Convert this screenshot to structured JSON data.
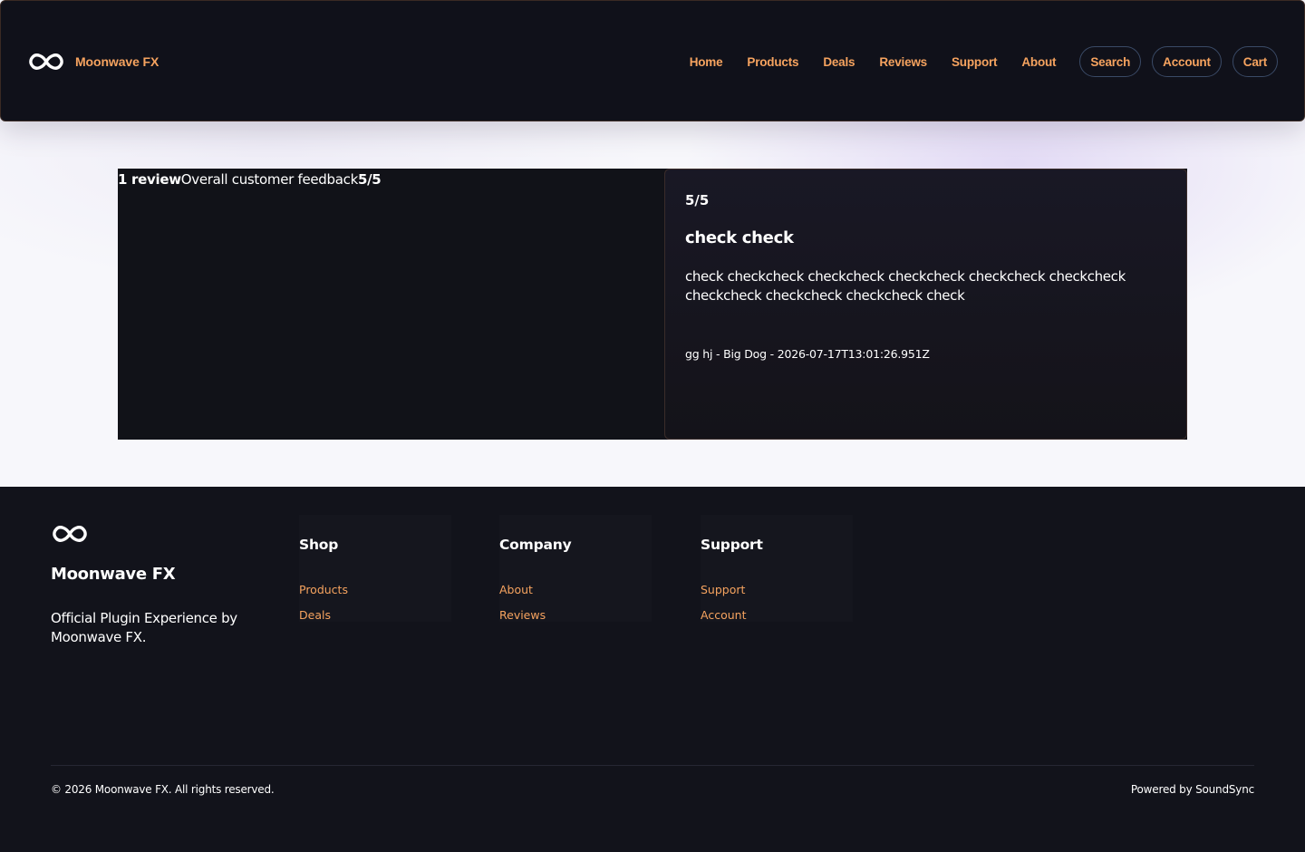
{
  "header": {
    "brand_name": "Moonwave FX",
    "nav_links": [
      "Home",
      "Products",
      "Deals",
      "Reviews",
      "Support",
      "About"
    ],
    "nav_pills": [
      "Search",
      "Account",
      "Cart"
    ]
  },
  "reviews": {
    "summary": {
      "count_label": "1 review",
      "caption": "Overall customer feedback",
      "average": "5/5"
    },
    "items": [
      {
        "score": "5/5",
        "title": "check check",
        "body": "check checkcheck checkcheck checkcheck checkcheck checkcheck checkcheck checkcheck checkcheck check",
        "meta": "gg hj - Big Dog - 2026-07-17T13:01:26.951Z"
      }
    ]
  },
  "footer": {
    "brand_name": "Moonwave FX",
    "tagline": "Official Plugin Experience by Moonwave FX.",
    "columns": [
      {
        "heading": "Shop",
        "links": [
          "Products",
          "Deals"
        ]
      },
      {
        "heading": "Company",
        "links": [
          "About",
          "Reviews"
        ]
      },
      {
        "heading": "Support",
        "links": [
          "Support",
          "Account"
        ]
      }
    ],
    "copyright": "© 2026 Moonwave FX. All rights reserved.",
    "powered_by": "Powered by SoundSync"
  },
  "colors": {
    "accent": "#f6a35f",
    "header_bg": "#10111a",
    "footer_bg": "#12131b",
    "page_bg": "#f6f5fb"
  },
  "icons": {
    "brand": "infinity-icon"
  }
}
